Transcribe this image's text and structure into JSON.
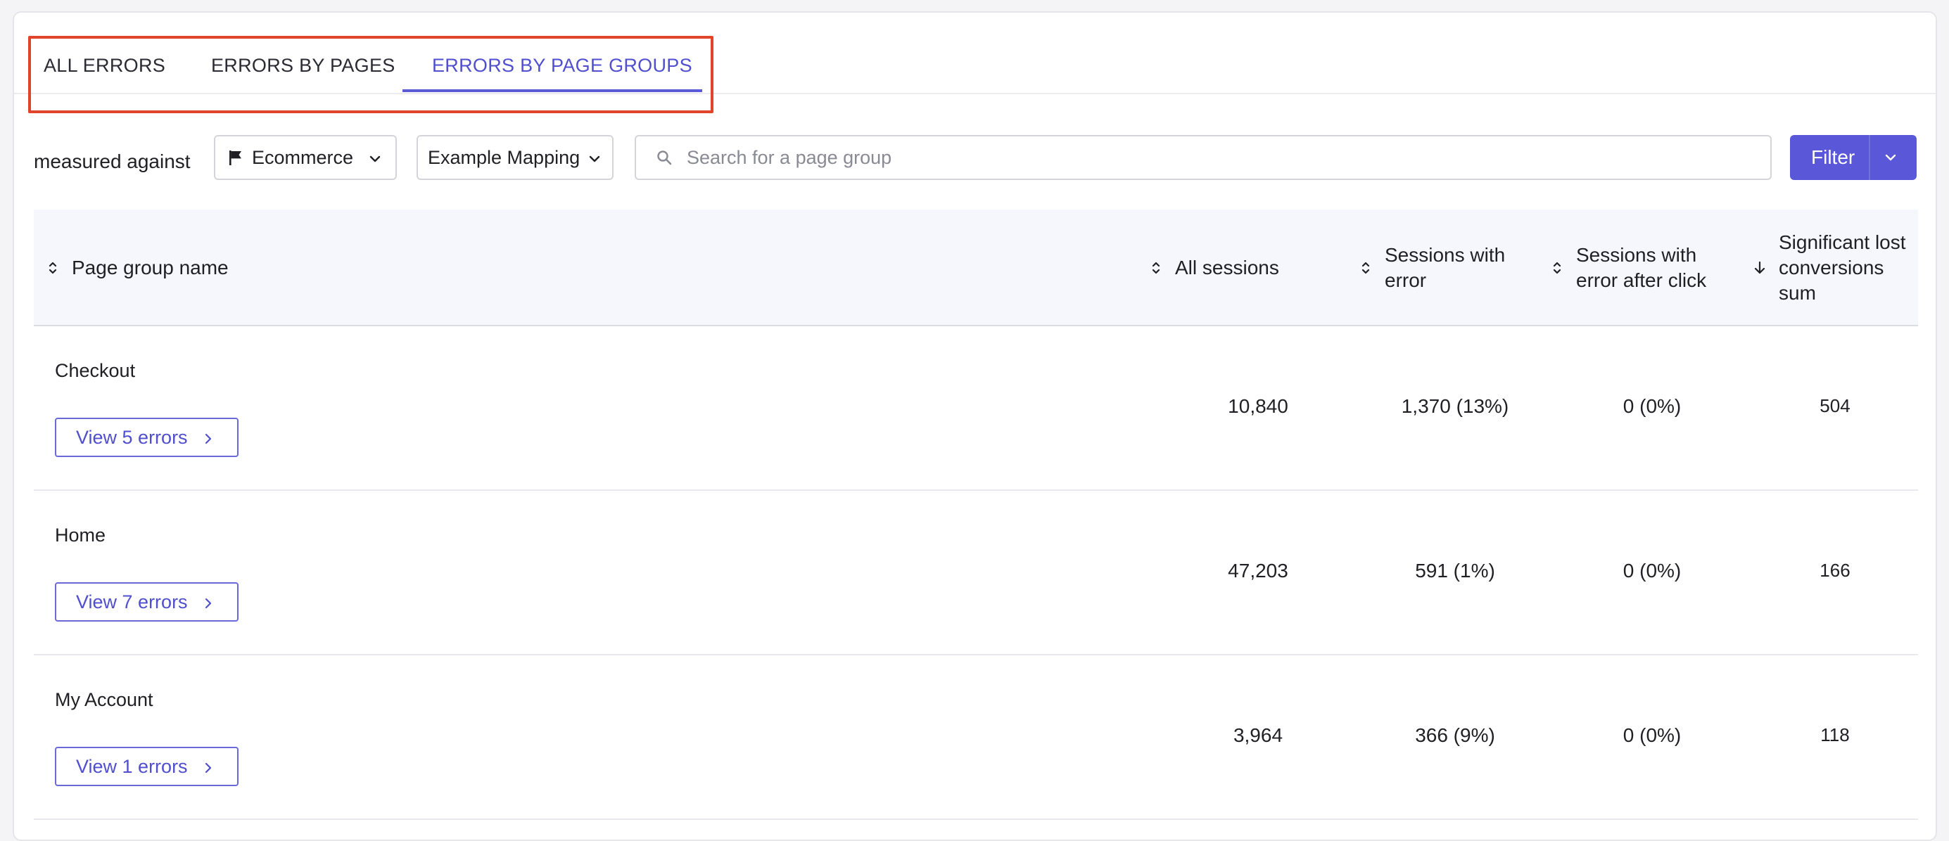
{
  "tabs": [
    {
      "label": "ALL ERRORS",
      "active": false
    },
    {
      "label": "ERRORS BY PAGES",
      "active": false
    },
    {
      "label": "ERRORS BY PAGE GROUPS",
      "active": true
    }
  ],
  "filters": {
    "measured_label": "measured against",
    "goal_dropdown": {
      "value": "Ecommerce",
      "icon": "flag-icon"
    },
    "mapping_dropdown": {
      "value": "Example Mapping"
    },
    "search": {
      "placeholder": "Search for a page group",
      "value": ""
    },
    "filter_button": {
      "label": "Filter"
    }
  },
  "table": {
    "headers": {
      "name": "Page group name",
      "all_sessions": "All sessions",
      "sessions_error_1": "Sessions with",
      "sessions_error_2": "error",
      "after_click_1": "Sessions with",
      "after_click_2": "error after click",
      "lost_1": "Significant lost",
      "lost_2": "conversions",
      "lost_3": "sum"
    },
    "rows": [
      {
        "name": "Checkout",
        "view_label": "View 5 errors",
        "all_sessions": "10,840",
        "sessions_with_error": "1,370 (13%)",
        "after_click": "0 (0%)",
        "lost_conversions": "504"
      },
      {
        "name": "Home",
        "view_label": "View 7 errors",
        "all_sessions": "47,203",
        "sessions_with_error": "591 (1%)",
        "after_click": "0 (0%)",
        "lost_conversions": "166"
      },
      {
        "name": "My Account",
        "view_label": "View 1 errors",
        "all_sessions": "3,964",
        "sessions_with_error": "366 (9%)",
        "after_click": "0 (0%)",
        "lost_conversions": "118"
      }
    ]
  },
  "colors": {
    "accent": "#5a57d8",
    "active_tab": "#4f4fd0",
    "highlight": "#e0442a"
  }
}
